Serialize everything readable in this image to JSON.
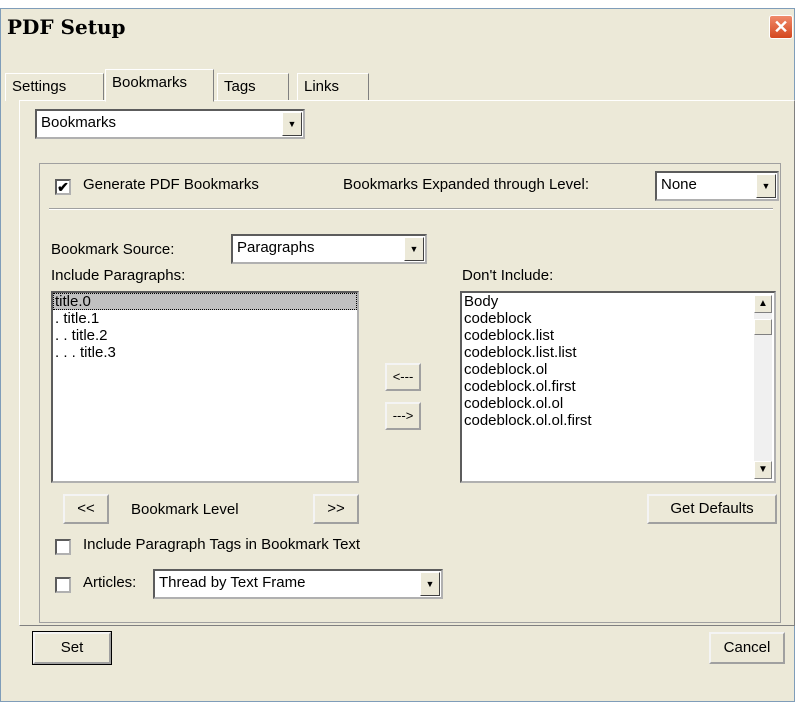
{
  "window": {
    "title": "PDF Setup",
    "close_glyph": "✕"
  },
  "tabs": [
    {
      "label": "Settings"
    },
    {
      "label": "Bookmarks"
    },
    {
      "label": "Tags"
    },
    {
      "label": "Links"
    }
  ],
  "section_select": {
    "value": "Bookmarks"
  },
  "generate_bookmarks": {
    "checked": true,
    "label": "Generate PDF Bookmarks"
  },
  "expanded_level": {
    "label": "Bookmarks Expanded through Level:",
    "value": "None"
  },
  "bookmark_source": {
    "label": "Bookmark Source:",
    "value": "Paragraphs"
  },
  "include_list": {
    "label": "Include Paragraphs:",
    "items": [
      "title.0",
      ". title.1",
      ". . title.2",
      ". . . title.3"
    ],
    "selected_index": 0
  },
  "exclude_list": {
    "label": "Don't Include:",
    "items": [
      "Body",
      "codeblock",
      "codeblock.list",
      "codeblock.list.list",
      "codeblock.ol",
      "codeblock.ol.first",
      "codeblock.ol.ol",
      "codeblock.ol.ol.first"
    ]
  },
  "move_buttons": {
    "left": "<---",
    "right": "--->"
  },
  "level_controls": {
    "decrease": "<<",
    "label": "Bookmark Level",
    "increase": ">>"
  },
  "get_defaults": "Get Defaults",
  "include_tags": {
    "checked": false,
    "label": "Include Paragraph Tags in Bookmark Text"
  },
  "articles": {
    "checked": false,
    "label": "Articles:",
    "value": "Thread by Text Frame"
  },
  "footer": {
    "set": "Set",
    "cancel": "Cancel"
  },
  "icons": {
    "checkbox_check": "✔",
    "dropdown_arrow": "▼",
    "scroll_up": "▲",
    "scroll_down": "▼"
  }
}
